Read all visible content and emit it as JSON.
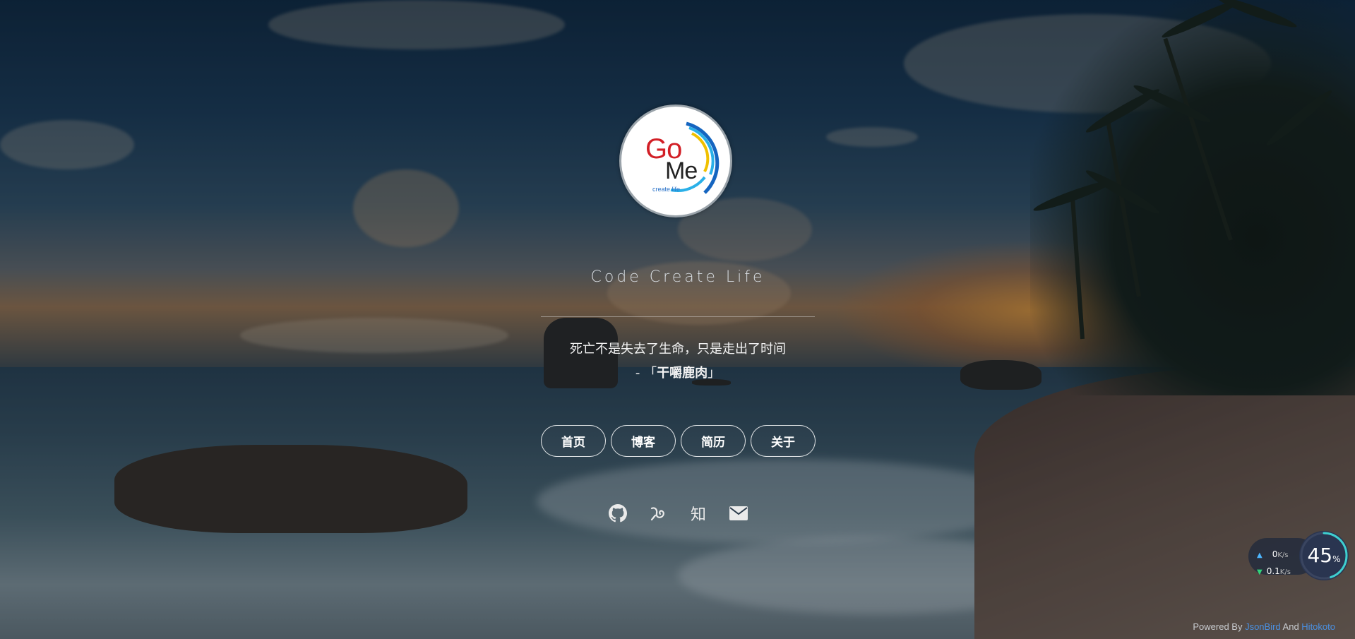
{
  "site": {
    "title": "Code Create Life",
    "logo": {
      "text_go": "Go",
      "text_me": "Me",
      "text_sub": "create life"
    }
  },
  "quote": {
    "text": "死亡不是失去了生命，只是走出了时间",
    "author_prefix": "- 「",
    "author": "干嚼鹿肉",
    "author_suffix": "」"
  },
  "nav": [
    {
      "label": "首页"
    },
    {
      "label": "博客"
    },
    {
      "label": "简历"
    },
    {
      "label": "关于"
    }
  ],
  "social": [
    {
      "icon": "github-icon"
    },
    {
      "icon": "yuque-icon"
    },
    {
      "icon": "zhihu-icon",
      "glyph": "知"
    },
    {
      "icon": "mail-icon"
    }
  ],
  "speed_widget": {
    "upload": "0",
    "upload_unit": "K/s",
    "download": "0.1",
    "download_unit": "K/s",
    "percent": "45",
    "percent_unit": "%"
  },
  "footer": {
    "prefix": "Powered By ",
    "link1": "JsonBird",
    "middle": " And ",
    "link2": "Hitokoto"
  },
  "colors": {
    "logo_red": "#d21f26",
    "link_blue": "#4a90e2",
    "upload_arrow": "#4db6ff",
    "download_arrow": "#32d37a",
    "widget_ring": "#3ecfcf"
  }
}
